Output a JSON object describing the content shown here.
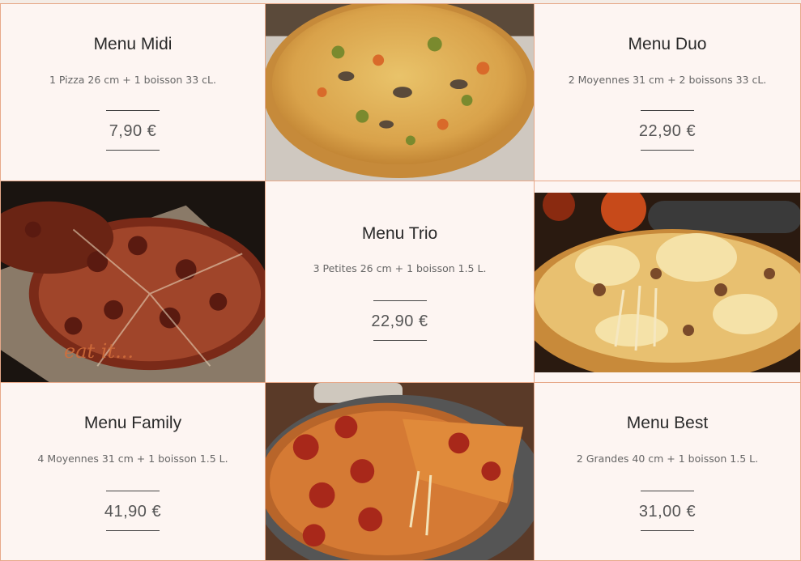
{
  "menus": [
    {
      "title": "Menu Midi",
      "description": "1 Pizza 26 cm + 1 boisson 33 cL.",
      "price": "7,90 €"
    },
    {
      "title": "Menu Duo",
      "description": "2 Moyennes 31 cm + 2 boissons 33 cL.",
      "price": "22,90 €"
    },
    {
      "title": "Menu Trio",
      "description": "3 Petites 26 cm + 1 boisson 1.5 L.",
      "price": "22,90 €"
    },
    {
      "title": "Menu Family",
      "description": "4 Moyennes 31 cm + 1 boisson 1.5 L.",
      "price": "41,90 €"
    },
    {
      "title": "Menu Best",
      "description": "2 Grandes 40 cm + 1 boisson 1.5 L.",
      "price": "31,00 €"
    }
  ],
  "photos": {
    "watermark": "eat it..."
  },
  "colors": {
    "card_background": "#fdf5f2",
    "card_border": "#e7a98a",
    "title": "#2a2a2a",
    "price": "#555555"
  }
}
